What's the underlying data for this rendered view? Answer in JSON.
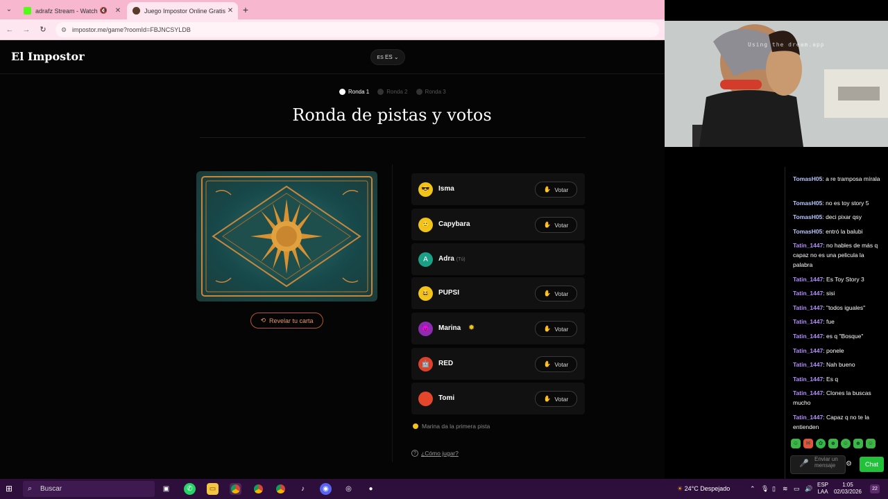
{
  "browser": {
    "tabs": [
      {
        "title": "adrafz Stream - Watch Live",
        "favicon_color": "#53fc18",
        "muted": true
      },
      {
        "title": "Juego Impostor Online Gratis",
        "favicon_color": "#5a3a2a",
        "active": true
      }
    ],
    "url": "impostor.me/game?roomId=FBJNCSYLDB"
  },
  "app": {
    "brand": "El Impostor",
    "language": "ES",
    "language_code": "ES",
    "rounds": [
      "Ronda 1",
      "Ronda 2",
      "Ronda 3"
    ],
    "active_round": 1,
    "heading": "Ronda de pistas y votos",
    "reveal_label": "Revelar tu carta",
    "vote_label": "Votar",
    "you_label": "(Tú)",
    "players": [
      {
        "name": "Isma",
        "avatar": "😎",
        "color": "#f0c419",
        "can_vote": true
      },
      {
        "name": "Capybara",
        "avatar": "🙂",
        "color": "#f0c419",
        "can_vote": true
      },
      {
        "name": "Adra",
        "avatar": "A",
        "color": "#1aa087",
        "can_vote": false,
        "is_you": true
      },
      {
        "name": "PUPSI",
        "avatar": "😆",
        "color": "#f0c419",
        "can_vote": true
      },
      {
        "name": "Marina",
        "avatar": "😈",
        "color": "#8e2bb0",
        "can_vote": true,
        "starter": true
      },
      {
        "name": "RED",
        "avatar": "🤖",
        "color": "#d9432b",
        "can_vote": true
      },
      {
        "name": "Tomi",
        "avatar": "●",
        "color": "#e2462b",
        "can_vote": true
      }
    ],
    "first_clue": "Marina da la primera pista",
    "how_to_play": "¿Cómo jugar?"
  },
  "webcam": {
    "watermark": "Using the dream.app"
  },
  "chat": {
    "messages": [
      {
        "user": "TomasH05",
        "text": "a re tramposa mírala",
        "color": "#b9c6ff"
      },
      {
        "user": "TomasH05",
        "text": "no es toy story 5",
        "color": "#b9c6ff"
      },
      {
        "user": "TomasH05",
        "text": "deci pixar qsy",
        "color": "#b9c6ff"
      },
      {
        "user": "TomasH05",
        "text": "entró la balubi",
        "color": "#b9c6ff"
      },
      {
        "user": "Tatin_1447",
        "text": "no hables de más q capaz no es una pelicula la palabra",
        "color": "#b48cff"
      },
      {
        "user": "Tatin_1447",
        "text": "Es Toy Story 3",
        "color": "#b48cff"
      },
      {
        "user": "Tatin_1447",
        "text": "sisi",
        "color": "#b48cff"
      },
      {
        "user": "Tatin_1447",
        "text": "\"todos iguales\"",
        "color": "#b48cff"
      },
      {
        "user": "Tatin_1447",
        "text": "fue",
        "color": "#b48cff"
      },
      {
        "user": "Tatin_1447",
        "text": "es q \"Bosque\"",
        "color": "#b48cff"
      },
      {
        "user": "Tatin_1447",
        "text": "ponele",
        "color": "#b48cff"
      },
      {
        "user": "Tatin_1447",
        "text": "Nah bueno",
        "color": "#b48cff"
      },
      {
        "user": "Tatin_1447",
        "text": "Es q",
        "color": "#b48cff"
      },
      {
        "user": "Tatin_1447",
        "text": "Clones la buscas mucho",
        "color": "#b48cff"
      },
      {
        "user": "Tatin_1447",
        "text": "Capaz q no te la entienden",
        "color": "#b48cff"
      }
    ],
    "input_placeholder": "Enviar un mensaje",
    "send_label": "Chat"
  },
  "taskbar": {
    "search_placeholder": "Buscar",
    "weather": "24°C Despejado",
    "lang_top": "ESP",
    "lang_bottom": "LAA",
    "time": "1:05",
    "date": "02/03/2026",
    "notifications": "22"
  }
}
